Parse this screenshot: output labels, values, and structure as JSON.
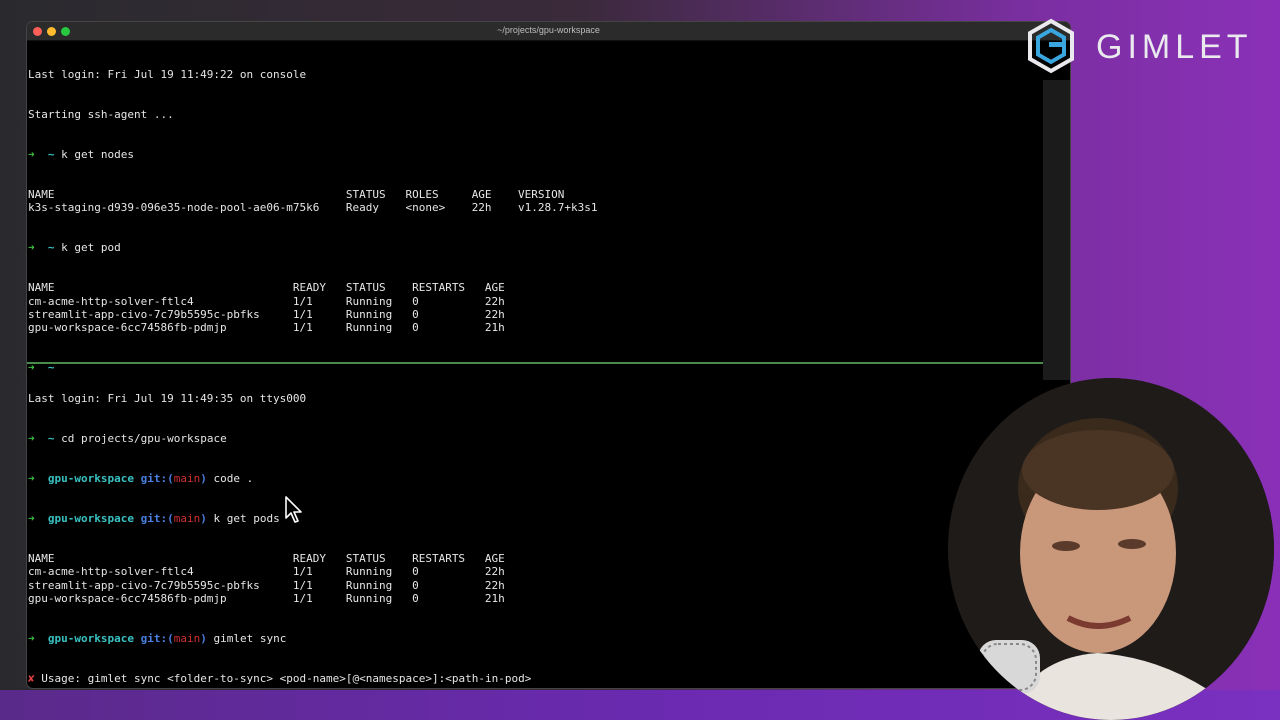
{
  "window": {
    "title": "~/projects/gpu-workspace"
  },
  "brand": {
    "name": "GIMLET",
    "logo_icon": "gimlet-hex-logo-icon",
    "accent": "#3aa6e0"
  },
  "top_pane": {
    "last_login": "Last login: Fri Jul 19 11:49:22 on console",
    "ssh_agent": "Starting ssh-agent ...",
    "cmd_nodes": {
      "arrow": "➜",
      "cwd": "~",
      "command": "k get nodes"
    },
    "nodes_header": [
      "NAME",
      "STATUS",
      "ROLES",
      "AGE",
      "VERSION"
    ],
    "nodes_rows": [
      [
        "k3s-staging-d939-096e35-node-pool-ae06-m75k6",
        "Ready",
        "<none>",
        "22h",
        "v1.28.7+k3s1"
      ]
    ],
    "cmd_pod": {
      "arrow": "➜",
      "cwd": "~",
      "command": "k get pod"
    },
    "pods_header": [
      "NAME",
      "READY",
      "STATUS",
      "RESTARTS",
      "AGE"
    ],
    "pods_rows": [
      [
        "cm-acme-http-solver-ftlc4",
        "1/1",
        "Running",
        "0",
        "22h"
      ],
      [
        "streamlit-app-civo-7c79b5595c-pbfks",
        "1/1",
        "Running",
        "0",
        "22h"
      ],
      [
        "gpu-workspace-6cc74586fb-pdmjp",
        "1/1",
        "Running",
        "0",
        "21h"
      ]
    ],
    "prompt_end": {
      "arrow": "➜",
      "cwd": "~"
    }
  },
  "bottom_pane": {
    "last_login": "Last login: Fri Jul 19 11:49:35 on ttys000",
    "cmd_cd": {
      "arrow": "➜",
      "cwd": "~",
      "command": "cd projects/gpu-workspace"
    },
    "prompt_dir": "gpu-workspace",
    "git_label": "git:(",
    "branch": "main",
    "git_close": ")",
    "cmd_code": "code .",
    "cmd_pods": "k get pods",
    "pods_header": [
      "NAME",
      "READY",
      "STATUS",
      "RESTARTS",
      "AGE"
    ],
    "pods_rows": [
      [
        "cm-acme-http-solver-ftlc4",
        "1/1",
        "Running",
        "0",
        "22h"
      ],
      [
        "streamlit-app-civo-7c79b5595c-pbfks",
        "1/1",
        "Running",
        "0",
        "22h"
      ],
      [
        "gpu-workspace-6cc74586fb-pdmjp",
        "1/1",
        "Running",
        "0",
        "21h"
      ]
    ],
    "cmd_sync": "gimlet sync",
    "error_mark": "✘",
    "usage": "Usage: gimlet sync <folder-to-sync> <pod-name>[@<namespace>]:<path-in-pod>"
  }
}
